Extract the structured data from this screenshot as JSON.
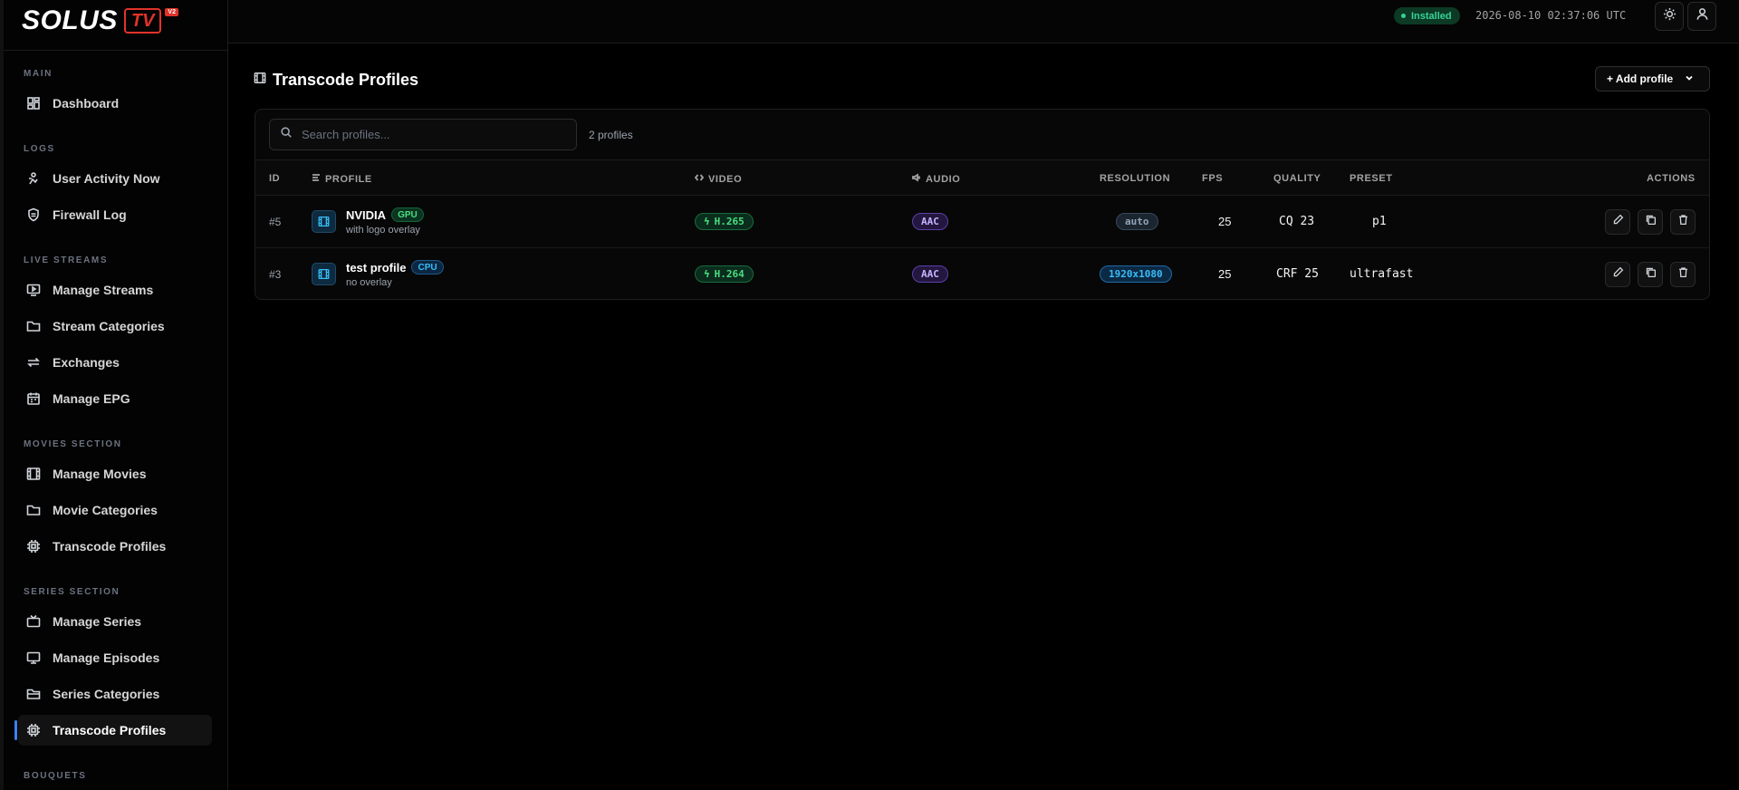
{
  "app": {
    "logo_word": "SOLUS",
    "logo_tv": "TV",
    "logo_badge": "V2"
  },
  "sidebar": {
    "sections": [
      {
        "label": "MAIN",
        "items": [
          {
            "label": "Dashboard",
            "icon": "dashboard-icon"
          }
        ]
      },
      {
        "label": "LOGS",
        "items": [
          {
            "label": "User Activity Now",
            "icon": "user-activity-icon"
          },
          {
            "label": "Firewall Log",
            "icon": "shield-icon"
          }
        ]
      },
      {
        "label": "LIVE STREAMS",
        "items": [
          {
            "label": "Manage Streams",
            "icon": "play-screen-icon"
          },
          {
            "label": "Stream Categories",
            "icon": "folder-icon"
          },
          {
            "label": "Exchanges",
            "icon": "exchange-icon"
          },
          {
            "label": "Manage EPG",
            "icon": "calendar-icon"
          }
        ]
      },
      {
        "label": "MOVIES SECTION",
        "items": [
          {
            "label": "Manage Movies",
            "icon": "film-icon"
          },
          {
            "label": "Movie Categories",
            "icon": "folder-icon"
          },
          {
            "label": "Transcode Profiles",
            "icon": "chip-icon"
          }
        ]
      },
      {
        "label": "SERIES SECTION",
        "items": [
          {
            "label": "Manage Series",
            "icon": "tv-icon"
          },
          {
            "label": "Manage Episodes",
            "icon": "monitor-icon"
          },
          {
            "label": "Series Categories",
            "icon": "folder-open-icon"
          },
          {
            "label": "Transcode Profiles",
            "icon": "chip-icon",
            "active": true
          }
        ]
      },
      {
        "label": "BOUQUETS",
        "items": []
      }
    ]
  },
  "topbar": {
    "status": "Installed",
    "status_color": "#34d399",
    "clock": "2026-08-10 02:37:06 UTC",
    "theme_icon": "sun-icon",
    "user_icon": "user-icon"
  },
  "header": {
    "title": "Transcode Profiles",
    "add_label": "+ Add profile"
  },
  "search": {
    "placeholder": "Search profiles...",
    "value": "",
    "count": "2 profiles"
  },
  "table": {
    "columns": {
      "id": "ID",
      "profile": "PROFILE",
      "video": "VIDEO",
      "audio": "AUDIO",
      "resolution": "RESOLUTION",
      "fps": "FPS",
      "quality": "QUALITY",
      "preset": "PRESET",
      "actions": "ACTIONS"
    },
    "rows": [
      {
        "id": "#5",
        "name": "NVIDIA",
        "tag": "GPU",
        "sub": "with logo overlay",
        "video": "H.265",
        "audio": "AAC",
        "resolution": "auto",
        "fps": "25",
        "quality": "CQ 23",
        "preset": "p1"
      },
      {
        "id": "#3",
        "name": "test profile",
        "tag": "CPU",
        "sub": "no overlay",
        "video": "H.264",
        "audio": "AAC",
        "resolution": "1920x1080",
        "fps": "25",
        "quality": "CRF 25",
        "preset": "ultrafast"
      }
    ]
  },
  "colors": {
    "accent": "#3b82f6",
    "brand": "#e0332a",
    "gpu": "#4ade80",
    "cpu": "#38bdf8",
    "audio": "#c4b5fd"
  }
}
